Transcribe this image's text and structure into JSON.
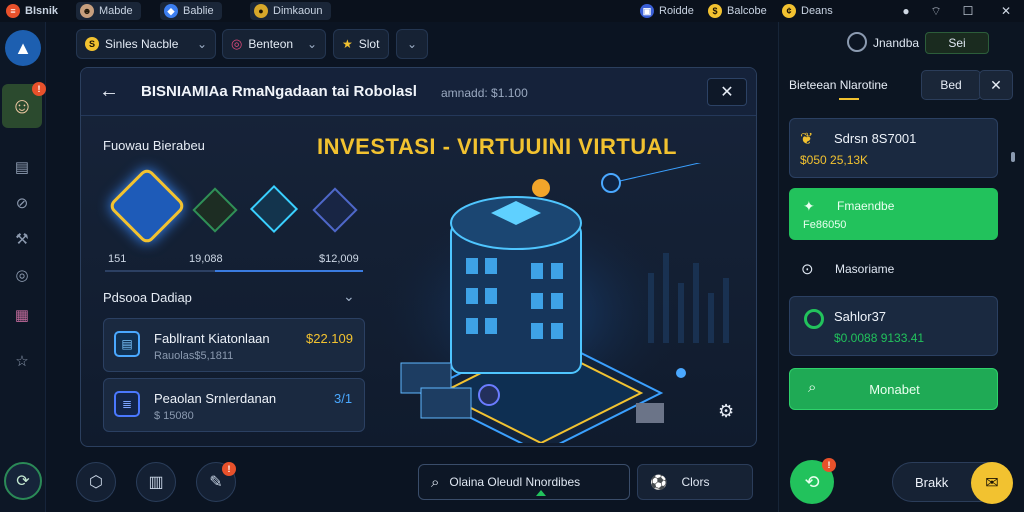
{
  "topbar": {
    "app_name": "BIsnik",
    "tab1_label": "Mabde",
    "tab2_label": "Bablie",
    "tab3_label": "Dimkaoun",
    "stat1": "Roidde",
    "stat2": "Balcobe",
    "stat3": "Deans"
  },
  "toolbar": {
    "dropdown1_label": "Sinles Nacble",
    "dropdown2_label": "Benteon",
    "button_label": "Slot"
  },
  "panel": {
    "title": "BISNIAMIAa RmaNgadaan tai Robolasl",
    "subtitle": "amnadd: $1.100",
    "headline": "INVESTASI - VIRTUUINI VIRTUAL",
    "section_label": "Fuowau Bierabeu",
    "stat_left": "151",
    "stat_mid": "19,088",
    "stat_right": "$12,009",
    "accordion_label": "Pdsooa Dadiap",
    "list": [
      {
        "title": "Fabllrant Kiatonlaan",
        "subtitle": "Rauolas$5,1811",
        "value": "$22.109"
      },
      {
        "title": "Peaolan Srnlerdanan",
        "subtitle": "$ 15080",
        "value": "3/1"
      }
    ]
  },
  "right": {
    "header_label": "Bieteean Nlarotine",
    "header_button": "Bed",
    "card1_title": "Sdrsn 8S7001",
    "card1_sub": "$050 25,13K",
    "card2_title": "Fmaendbe",
    "card2_sub": "Fe86050",
    "row_label": "Masoriame",
    "card3_title": "Sahlor37",
    "card3_sub": "$0.0088 9133.41",
    "green_button": "Monabet",
    "account_label": "Jnandba",
    "account_chip": "Sei"
  },
  "bottom": {
    "search_label": "Olaina Oleudl Nnordibes",
    "button_label": "Clors",
    "brand_label": "Brakk"
  },
  "colors": {
    "accent_yellow": "#f2c230",
    "accent_green": "#22c25c",
    "accent_blue": "#4aa8ff"
  }
}
